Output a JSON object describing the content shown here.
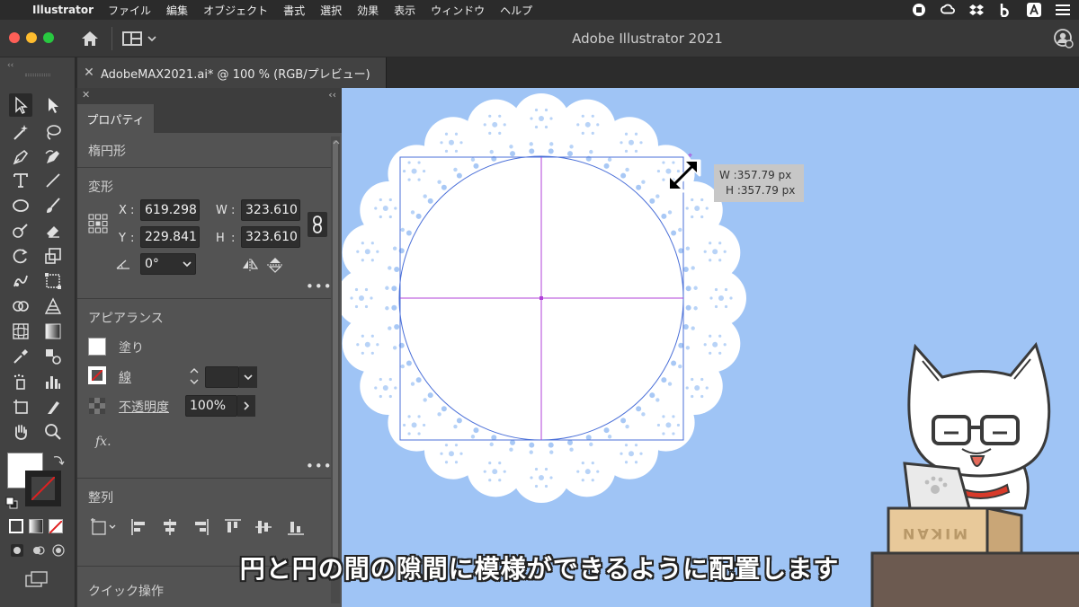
{
  "menubar": {
    "app_name": "Illustrator",
    "items": [
      "ファイル",
      "編集",
      "オブジェクト",
      "書式",
      "選択",
      "効果",
      "表示",
      "ウィンドウ",
      "ヘルプ"
    ]
  },
  "window": {
    "title": "Adobe Illustrator 2021",
    "tab_label": "AdobeMAX2021.ai* @ 100 % (RGB/プレビュー)"
  },
  "properties": {
    "tab": "プロパティ",
    "object_type": "楕円形",
    "transform": {
      "heading": "変形",
      "x_label": "X",
      "x_value": "619.298",
      "y_label": "Y",
      "y_value": "229.841",
      "w_label": "W",
      "w_value": "323.610",
      "h_label": "H",
      "h_value": "323.610",
      "angle_value": "0°"
    },
    "appearance": {
      "heading": "アピアランス",
      "fill_label": "塗り",
      "stroke_label": "線",
      "opacity_label": "不透明度",
      "opacity_value": "100%",
      "fx_label": "fx."
    },
    "align": {
      "heading": "整列"
    },
    "quick_actions": {
      "heading": "クイック操作"
    },
    "more_label": "•••"
  },
  "canvas": {
    "tooltip_w": "W :357.79 px",
    "tooltip_h": "H :357.79 px",
    "box_label": "MIKAN"
  },
  "caption": "円と円の間の隙間に模様ができるように配置します",
  "colors": {
    "canvas_bg": "#9fc4f5",
    "selection": "#4a6fd8",
    "center_guide": "#b040d8",
    "stroke_none": "#e02020"
  }
}
